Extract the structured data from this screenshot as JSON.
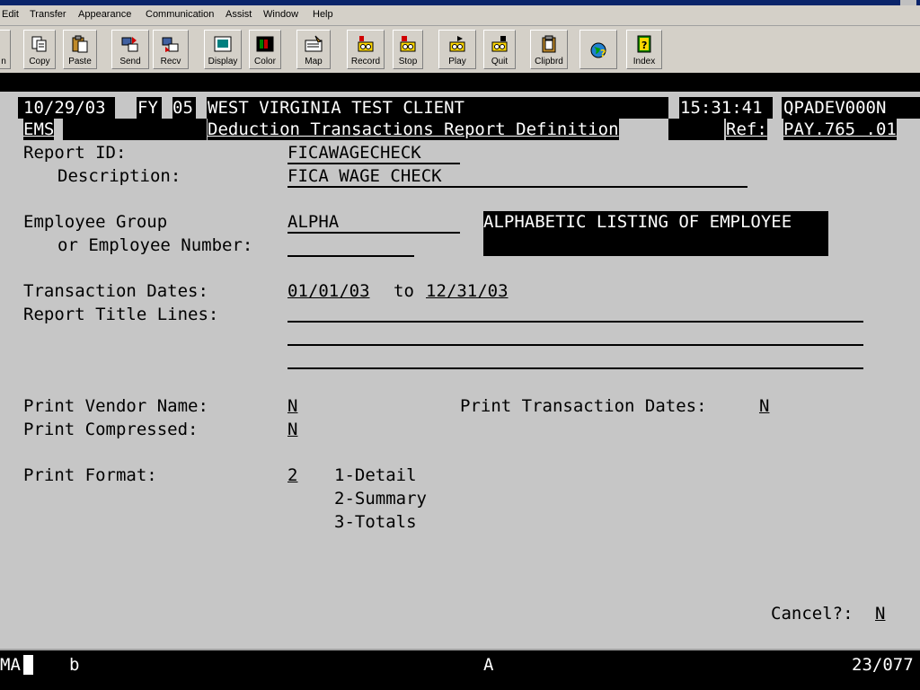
{
  "menu": [
    "Edit",
    "Transfer",
    "Appearance",
    "Communication",
    "Assist",
    "Window",
    "Help"
  ],
  "toolbar": [
    {
      "label": "n",
      "icon": "partial-icon"
    },
    {
      "label": "Copy",
      "icon": "copy-icon"
    },
    {
      "label": "Paste",
      "icon": "paste-icon"
    },
    {
      "label": "Send",
      "icon": "send-icon"
    },
    {
      "label": "Recv",
      "icon": "receive-icon"
    },
    {
      "label": "Display",
      "icon": "display-icon"
    },
    {
      "label": "Color",
      "icon": "color-icon"
    },
    {
      "label": "Map",
      "icon": "map-icon"
    },
    {
      "label": "Record",
      "icon": "record-icon"
    },
    {
      "label": "Stop",
      "icon": "stop-icon"
    },
    {
      "label": "Play",
      "icon": "play-icon"
    },
    {
      "label": "Quit",
      "icon": "quit-icon"
    },
    {
      "label": "Clipbrd",
      "icon": "clipboard-icon"
    },
    {
      "label": "",
      "icon": "globe-help-icon"
    },
    {
      "label": "Index",
      "icon": "index-icon"
    }
  ],
  "header": {
    "date": "10/29/03",
    "fy_label": "FY",
    "fy_value": "05",
    "client": "WEST VIRGINIA TEST CLIENT",
    "time": "15:31:41",
    "system": "QPADEV000N",
    "app": "EMS",
    "title": "Deduction Transactions Report Definition",
    "ref_label": "Ref:",
    "ref_value": "PAY.765 .01"
  },
  "form": {
    "report_id_label": "Report ID:",
    "report_id_value": "FICAWAGECHECK",
    "description_label": "Description:",
    "description_value": "FICA WAGE CHECK",
    "employee_group_label": "Employee Group",
    "employee_group_value": "ALPHA",
    "employee_group_desc": "ALPHABETIC LISTING OF EMPLOYEE",
    "employee_number_label": "or Employee Number:",
    "employee_number_value": "",
    "transaction_dates_label": "Transaction Dates:",
    "date_from": "01/01/03",
    "date_to_label": "to",
    "date_to": "12/31/03",
    "report_title_lines_label": "Report Title Lines:",
    "title_line_1": "",
    "title_line_2": "",
    "title_line_3": "",
    "print_vendor_label": "Print Vendor Name:",
    "print_vendor_value": "N",
    "print_trans_dates_label": "Print Transaction Dates:",
    "print_trans_dates_value": "N",
    "print_compressed_label": "Print Compressed:",
    "print_compressed_value": "N",
    "print_format_label": "Print Format:",
    "print_format_value": "2",
    "print_format_options": [
      "1-Detail",
      "2-Summary",
      "3-Totals"
    ],
    "cancel_label": "Cancel?:",
    "cancel_value": "N"
  },
  "status": {
    "mode": "MA",
    "b": "b",
    "a": "A",
    "position": "23/077"
  }
}
